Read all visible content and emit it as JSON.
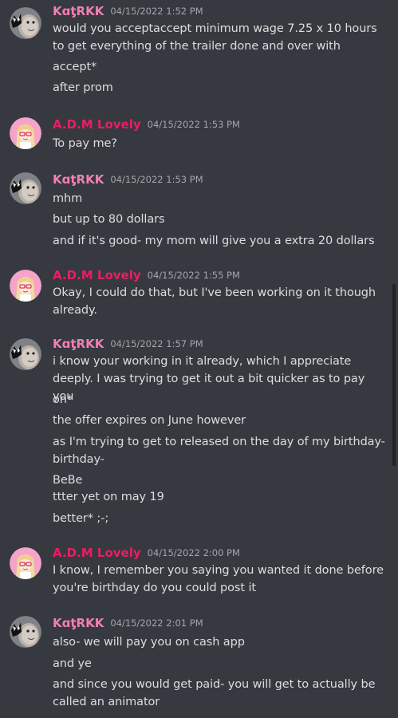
{
  "colors": {
    "background": "#36393f",
    "katrkk_name": "#f47fb2",
    "adm_name": "#e91e63",
    "message_text": "#dcddde",
    "timestamp": "#a3a6aa"
  },
  "messages": [
    {
      "author": "KɑƫRKK",
      "avatar": "katrkk-avatar",
      "timestamp": "04/15/2022 1:52 PM",
      "lines": [
        "would you acceptaccept minimum wage 7.25 x 10 hours to get everything of the trailer done and over with",
        "accept*",
        "after prom"
      ]
    },
    {
      "author": "A.D.M Lovely",
      "avatar": "adm-avatar",
      "timestamp": "04/15/2022 1:53 PM",
      "lines": [
        "To pay me?"
      ]
    },
    {
      "author": "KɑƫRKK",
      "avatar": "katrkk-avatar",
      "timestamp": "04/15/2022 1:53 PM",
      "lines": [
        "mhm",
        "but up to 80 dollars",
        "and if it's good- my mom will give you a extra 20 dollars"
      ]
    },
    {
      "author": "A.D.M Lovely",
      "avatar": "adm-avatar",
      "timestamp": "04/15/2022 1:55 PM",
      "lines": [
        "Okay, I could do that, but I've been working on it though already."
      ]
    },
    {
      "author": "KɑƫRKK",
      "avatar": "katrkk-avatar",
      "timestamp": "04/15/2022 1:57 PM",
      "lines": [
        "i know your working in it already, which I appreciate deeply. I was trying to get it out a bit quicker as to pay you",
        "on*",
        "the offer expires on June however",
        "as I'm trying to get to released on the day of my birthday- birthday-",
        "BeBe",
        "ttter yet on may 19",
        "better* ;-;"
      ]
    },
    {
      "author": "A.D.M Lovely",
      "avatar": "adm-avatar",
      "timestamp": "04/15/2022 2:00 PM",
      "lines": [
        "I know, I remember you saying you wanted it done before you're birthday do you could post it"
      ]
    },
    {
      "author": "KɑƫRKK",
      "avatar": "katrkk-avatar",
      "timestamp": "04/15/2022 2:01 PM",
      "lines": [
        "also- we will pay you on cash app",
        "and ye",
        "and since you would get paid- you will get to actually be called an animator"
      ]
    }
  ]
}
